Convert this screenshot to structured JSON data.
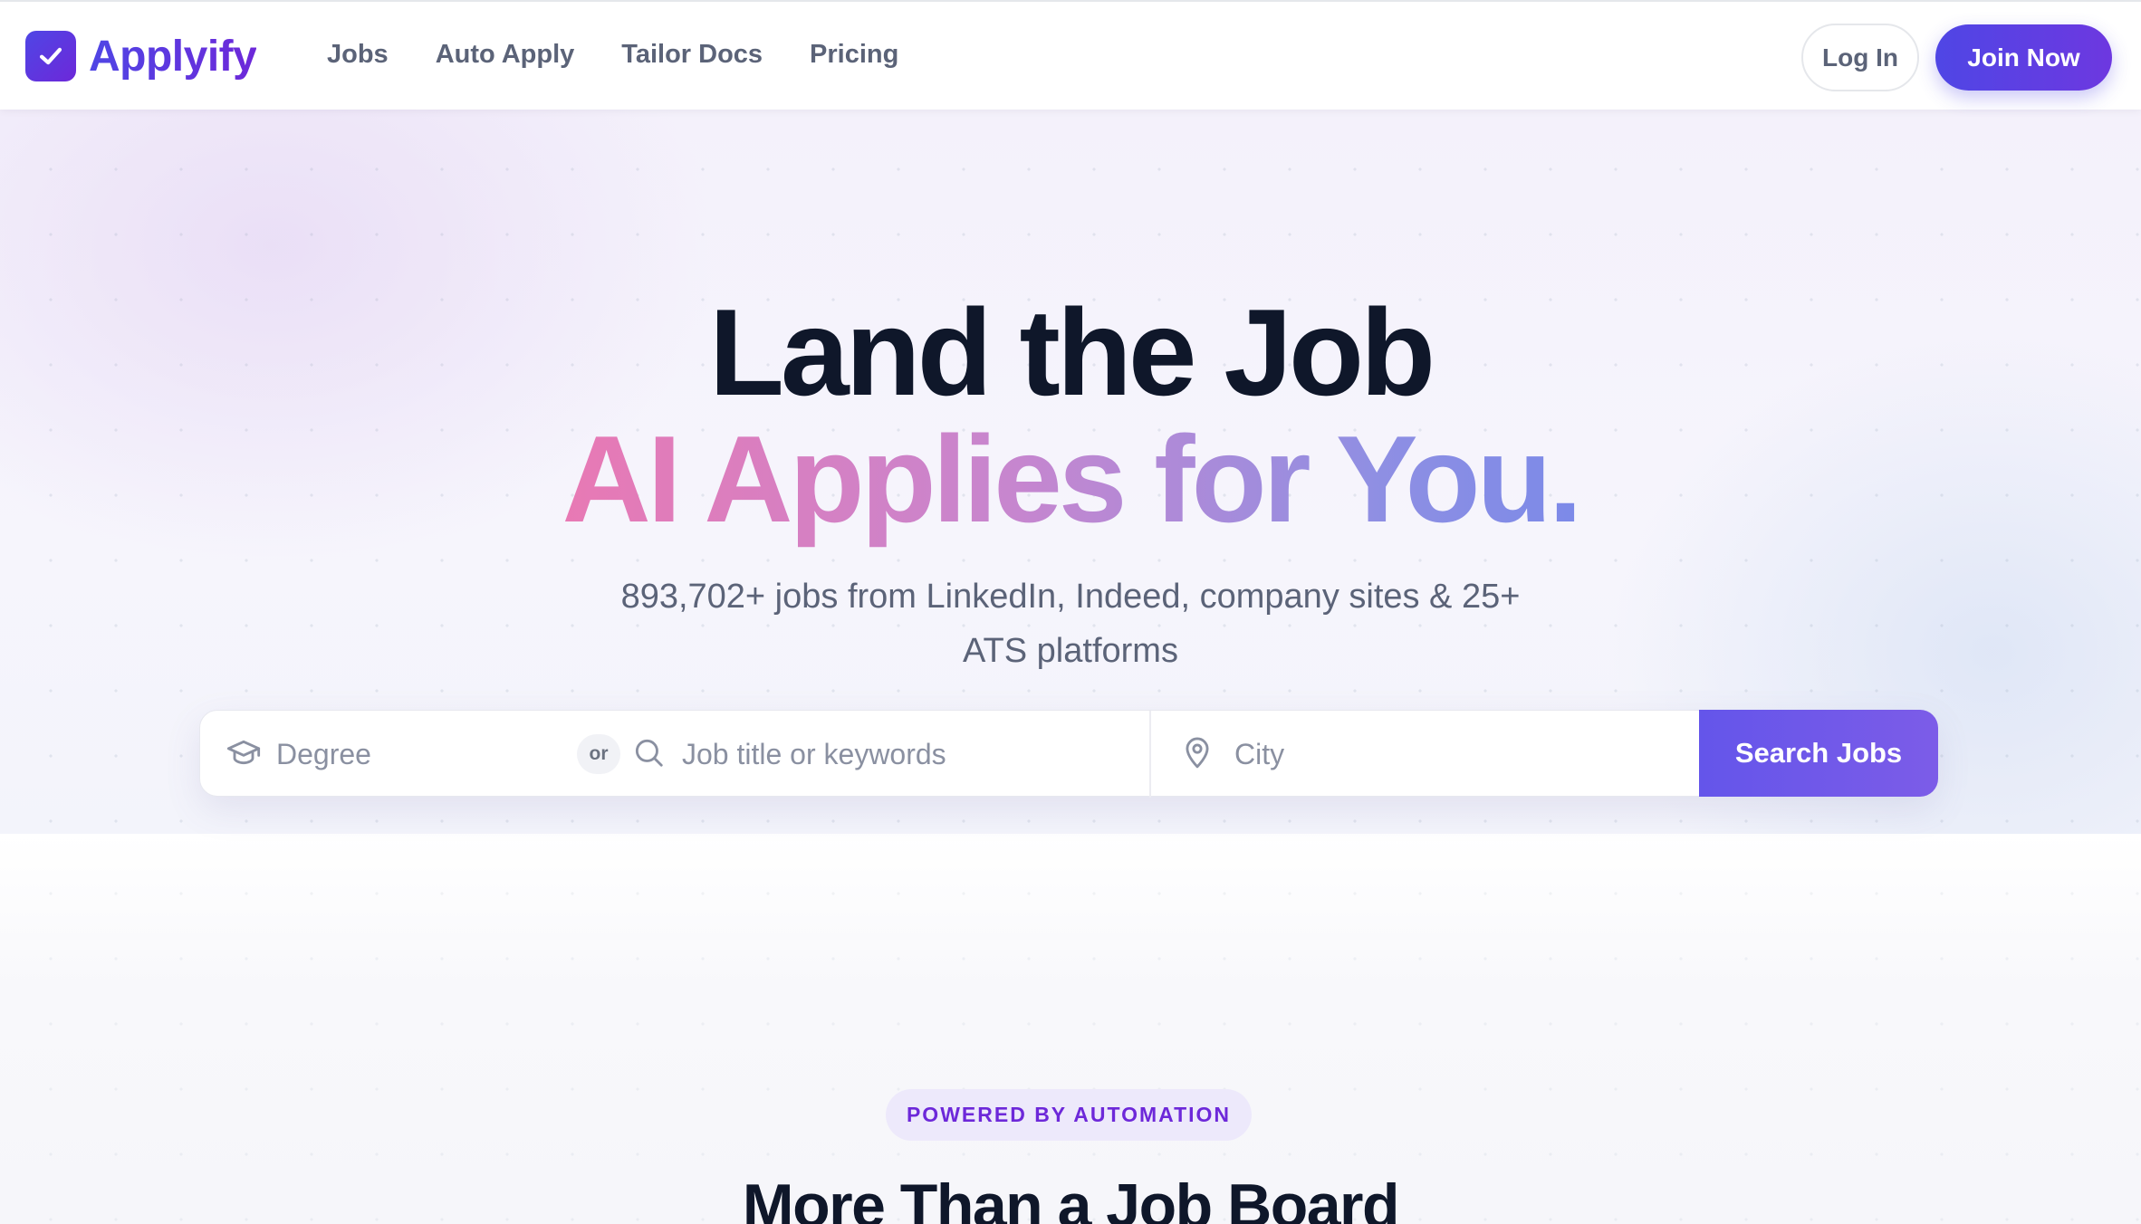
{
  "brand": {
    "name": "Applyify",
    "accent": "#4f46e5",
    "accent_end": "#6d28d9"
  },
  "nav": {
    "links": [
      "Jobs",
      "Auto Apply",
      "Tailor Docs",
      "Pricing"
    ],
    "login_label": "Log In",
    "join_label": "Join Now"
  },
  "hero": {
    "headline_line1": "Land the Job",
    "headline_line2": "AI Applies for You.",
    "subtitle_line1": "893,702+ jobs from LinkedIn, Indeed, company sites & 25+",
    "subtitle_line2": "ATS platforms"
  },
  "search": {
    "degree_placeholder": "Degree",
    "or_label": "or",
    "job_placeholder": "Job title or keywords",
    "city_placeholder": "City",
    "button_label": "Search Jobs",
    "icons": {
      "degree": "graduation-cap-icon",
      "job": "search-icon",
      "city": "map-pin-icon"
    }
  },
  "features": {
    "badge": "POWERED BY AUTOMATION",
    "title": "More Than a Job Board"
  }
}
